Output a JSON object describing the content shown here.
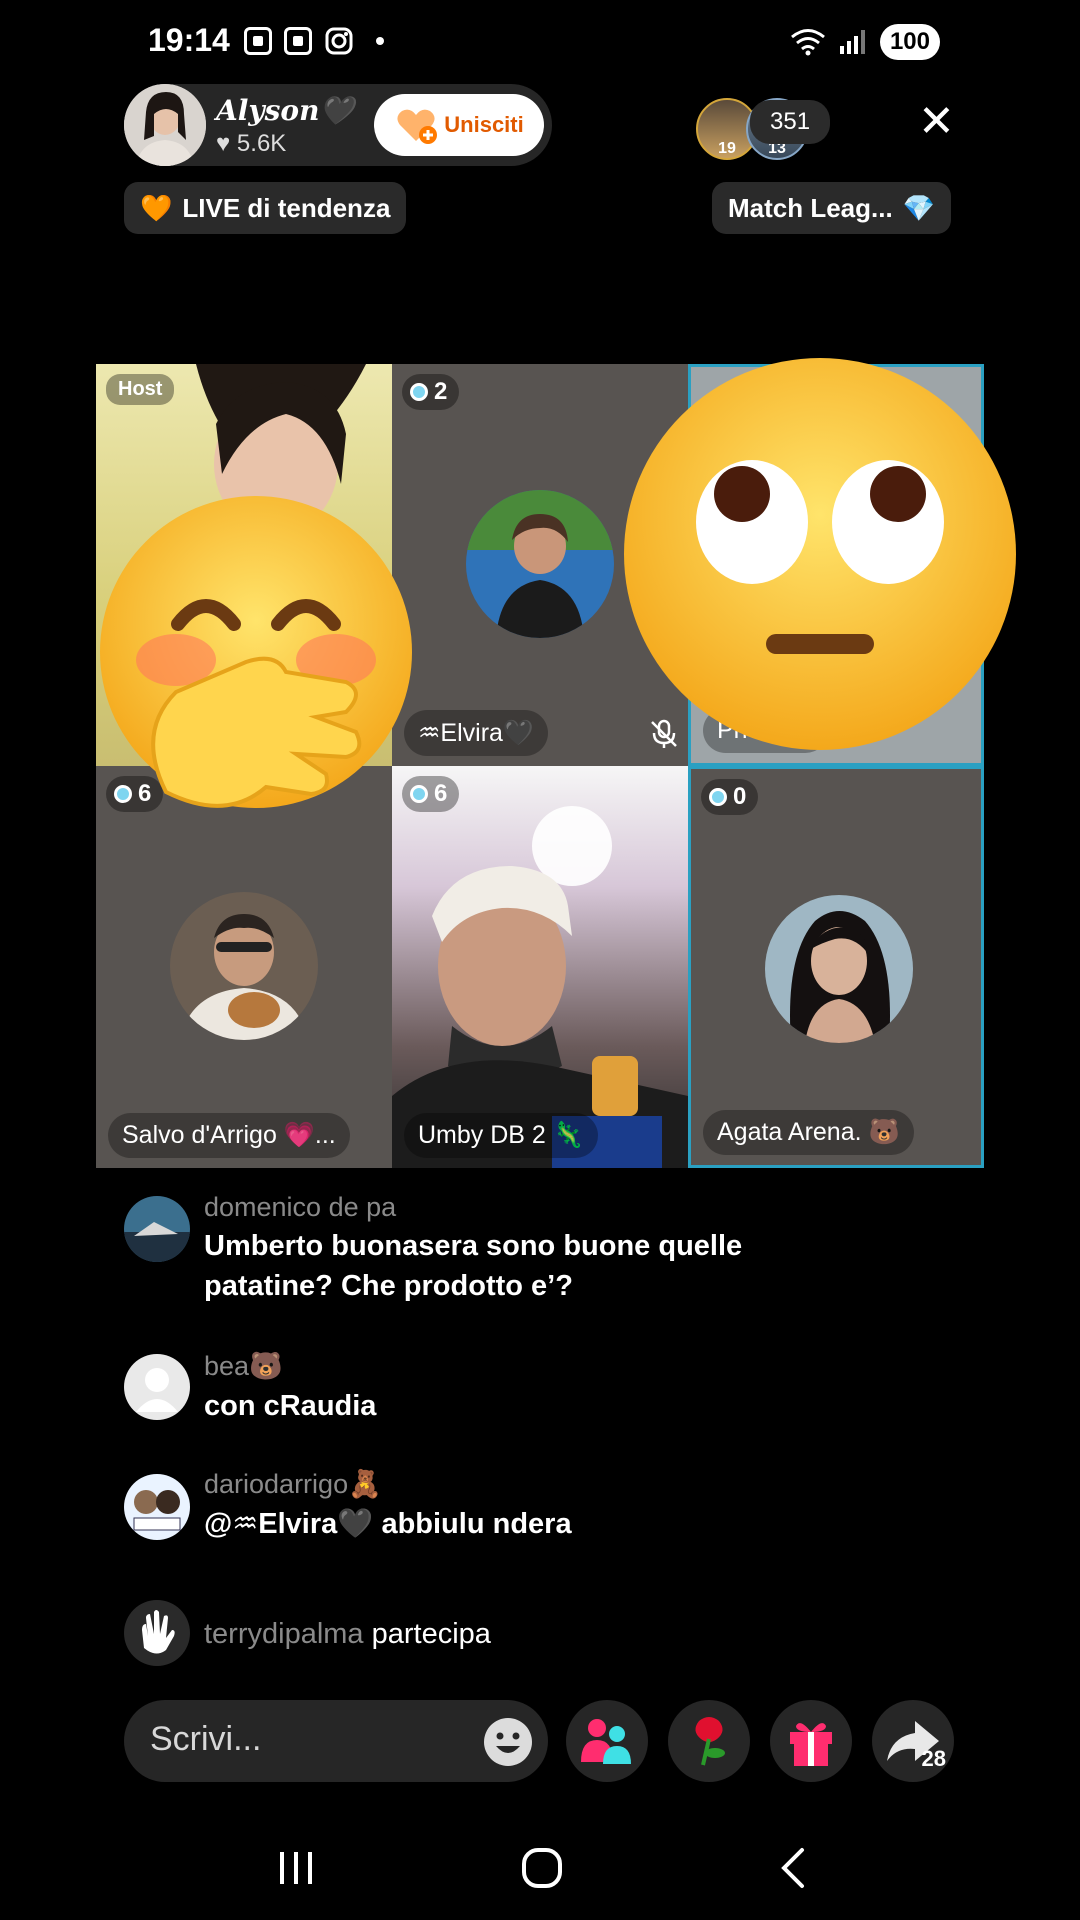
{
  "status_bar": {
    "time": "19:14",
    "battery": "100",
    "icons": [
      "screenshot-icon",
      "screen-record-icon",
      "instagram-icon",
      "notification-dot",
      "wifi-icon",
      "signal-icon"
    ]
  },
  "header": {
    "host_name": "Alyson🖤",
    "host_likes": "5.6K",
    "join_label": "Unisciti",
    "viewer_badges": [
      "19",
      "13"
    ],
    "viewer_count": "351",
    "trend_label": "LIVE di tendenza",
    "match_label": "Match Leag..."
  },
  "grid": {
    "host_label": "Host",
    "cells": [
      {
        "score": "",
        "name": "",
        "badge": "Host"
      },
      {
        "score": "2",
        "name": "♒Elvira🖤"
      },
      {
        "score": "",
        "name": "Prici In..."
      },
      {
        "score": "6",
        "name": "Salvo d'Arrigo 💗..."
      },
      {
        "score": "6",
        "name": "Umby DB 2 🦎"
      },
      {
        "score": "0",
        "name": "Agata Arena. 🐻"
      }
    ]
  },
  "chat": [
    {
      "user": "domenico de pa",
      "message": "Umberto buonasera sono buone quelle patatine? Che prodotto e’?"
    },
    {
      "user": "bea🐻",
      "message": "con cRaudia"
    },
    {
      "user": "dariodarrigo🧸",
      "message": "@♒Elvira🖤 abbiulu ndera"
    },
    {
      "user": "terrydipalma",
      "message": "partecipa"
    }
  ],
  "bottom_bar": {
    "input_placeholder": "Scrivi...",
    "share_count": "28"
  },
  "colors": {
    "accent_join": "#e15a00",
    "grid_border": "#2aa0c2",
    "pink": "#ff2d6f"
  }
}
